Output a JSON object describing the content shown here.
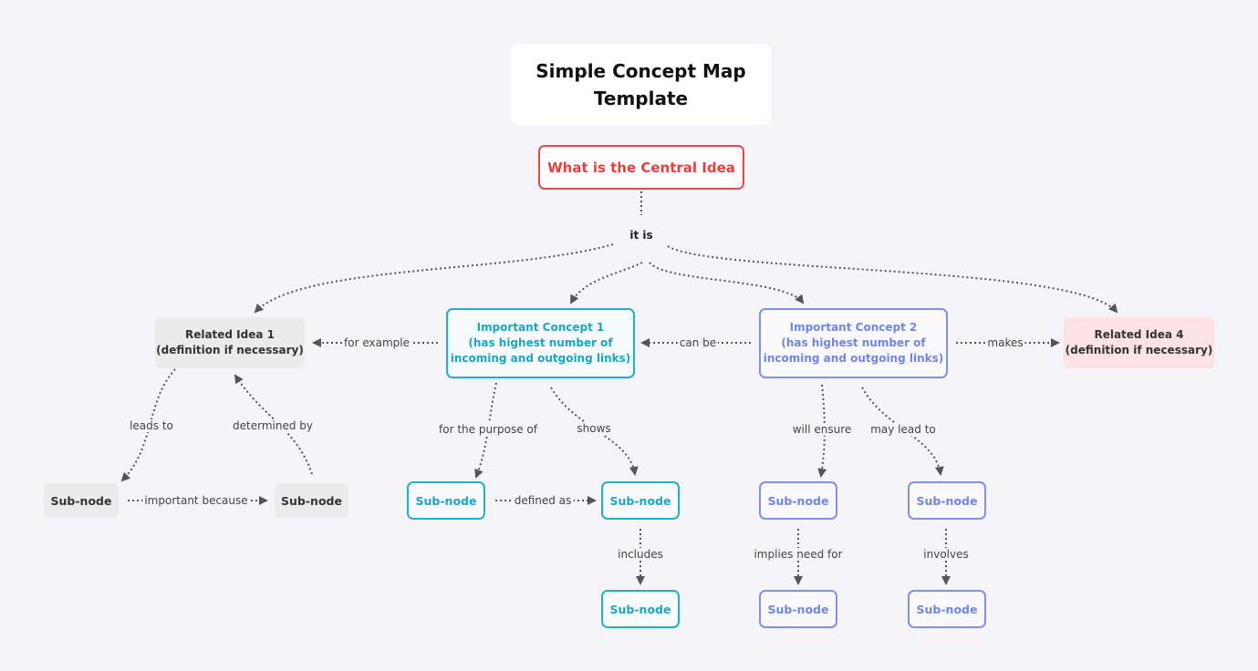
{
  "title": "Simple Concept Map\nTemplate",
  "central": "What is the Central Idea",
  "colors": {
    "background": "#f5f5f9",
    "central": "#e84a4a",
    "concept1": "#1fb0cc",
    "concept2": "#8091ec",
    "related1_bg": "#ebebeb",
    "related4_bg": "#fde2e5",
    "link": "#555555"
  },
  "nodes": {
    "related1": "Related Idea 1\n(definition if necessary)",
    "concept1": "Important Concept 1\n(has highest number of\nincoming and outgoing links)",
    "concept2": "Important Concept 2\n(has highest number of\nincoming and outgoing links)",
    "related4": "Related Idea 4\n(definition if necessary)",
    "r1_sub_left": "Sub-node",
    "r1_sub_right": "Sub-node",
    "c1_sub_left": "Sub-node",
    "c1_sub_right": "Sub-node",
    "c1_sub_bottom": "Sub-node",
    "c2_sub_left": "Sub-node",
    "c2_sub_right": "Sub-node",
    "c2_sub_left_bottom": "Sub-node",
    "c2_sub_right_bottom": "Sub-node"
  },
  "links": {
    "it_is": "it is",
    "for_example": "for example",
    "can_be": "can be",
    "makes": "makes",
    "leads_to": "leads to",
    "determined_by": "determined by",
    "important_because": "important because",
    "for_the_purpose_of": "for the purpose of",
    "shows": "shows",
    "defined_as": "defined as",
    "includes": "includes",
    "will_ensure": "will ensure",
    "may_lead_to": "may lead to",
    "implies_need_for": "implies need for",
    "involves": "involves"
  }
}
